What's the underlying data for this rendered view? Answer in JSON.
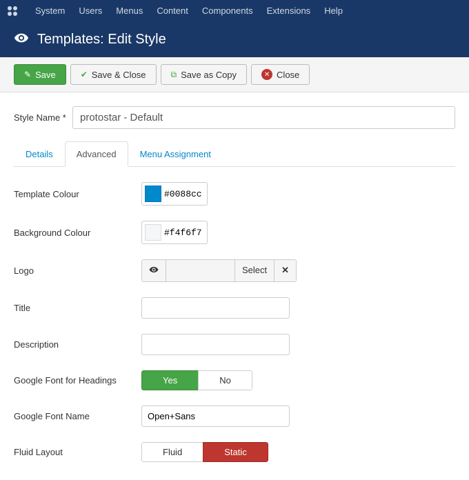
{
  "nav": {
    "items": [
      "System",
      "Users",
      "Menus",
      "Content",
      "Components",
      "Extensions",
      "Help"
    ]
  },
  "title": "Templates: Edit Style",
  "toolbar": {
    "save": "Save",
    "save_close": "Save & Close",
    "save_copy": "Save as Copy",
    "close": "Close"
  },
  "style_name": {
    "label": "Style Name *",
    "value": "protostar - Default"
  },
  "tabs": {
    "details": "Details",
    "advanced": "Advanced",
    "menu": "Menu Assignment"
  },
  "fields": {
    "template_colour": {
      "label": "Template Colour",
      "value": "#0088cc",
      "swatch": "#0088cc"
    },
    "bg_colour": {
      "label": "Background Colour",
      "value": "#f4f6f7",
      "swatch": "#f4f6f7"
    },
    "logo": {
      "label": "Logo",
      "select": "Select"
    },
    "title": {
      "label": "Title",
      "value": ""
    },
    "description": {
      "label": "Description",
      "value": ""
    },
    "gfont_headings": {
      "label": "Google Font for Headings",
      "yes": "Yes",
      "no": "No"
    },
    "gfont_name": {
      "label": "Google Font Name",
      "value": "Open+Sans"
    },
    "fluid": {
      "label": "Fluid Layout",
      "fluid": "Fluid",
      "static": "Static"
    }
  }
}
